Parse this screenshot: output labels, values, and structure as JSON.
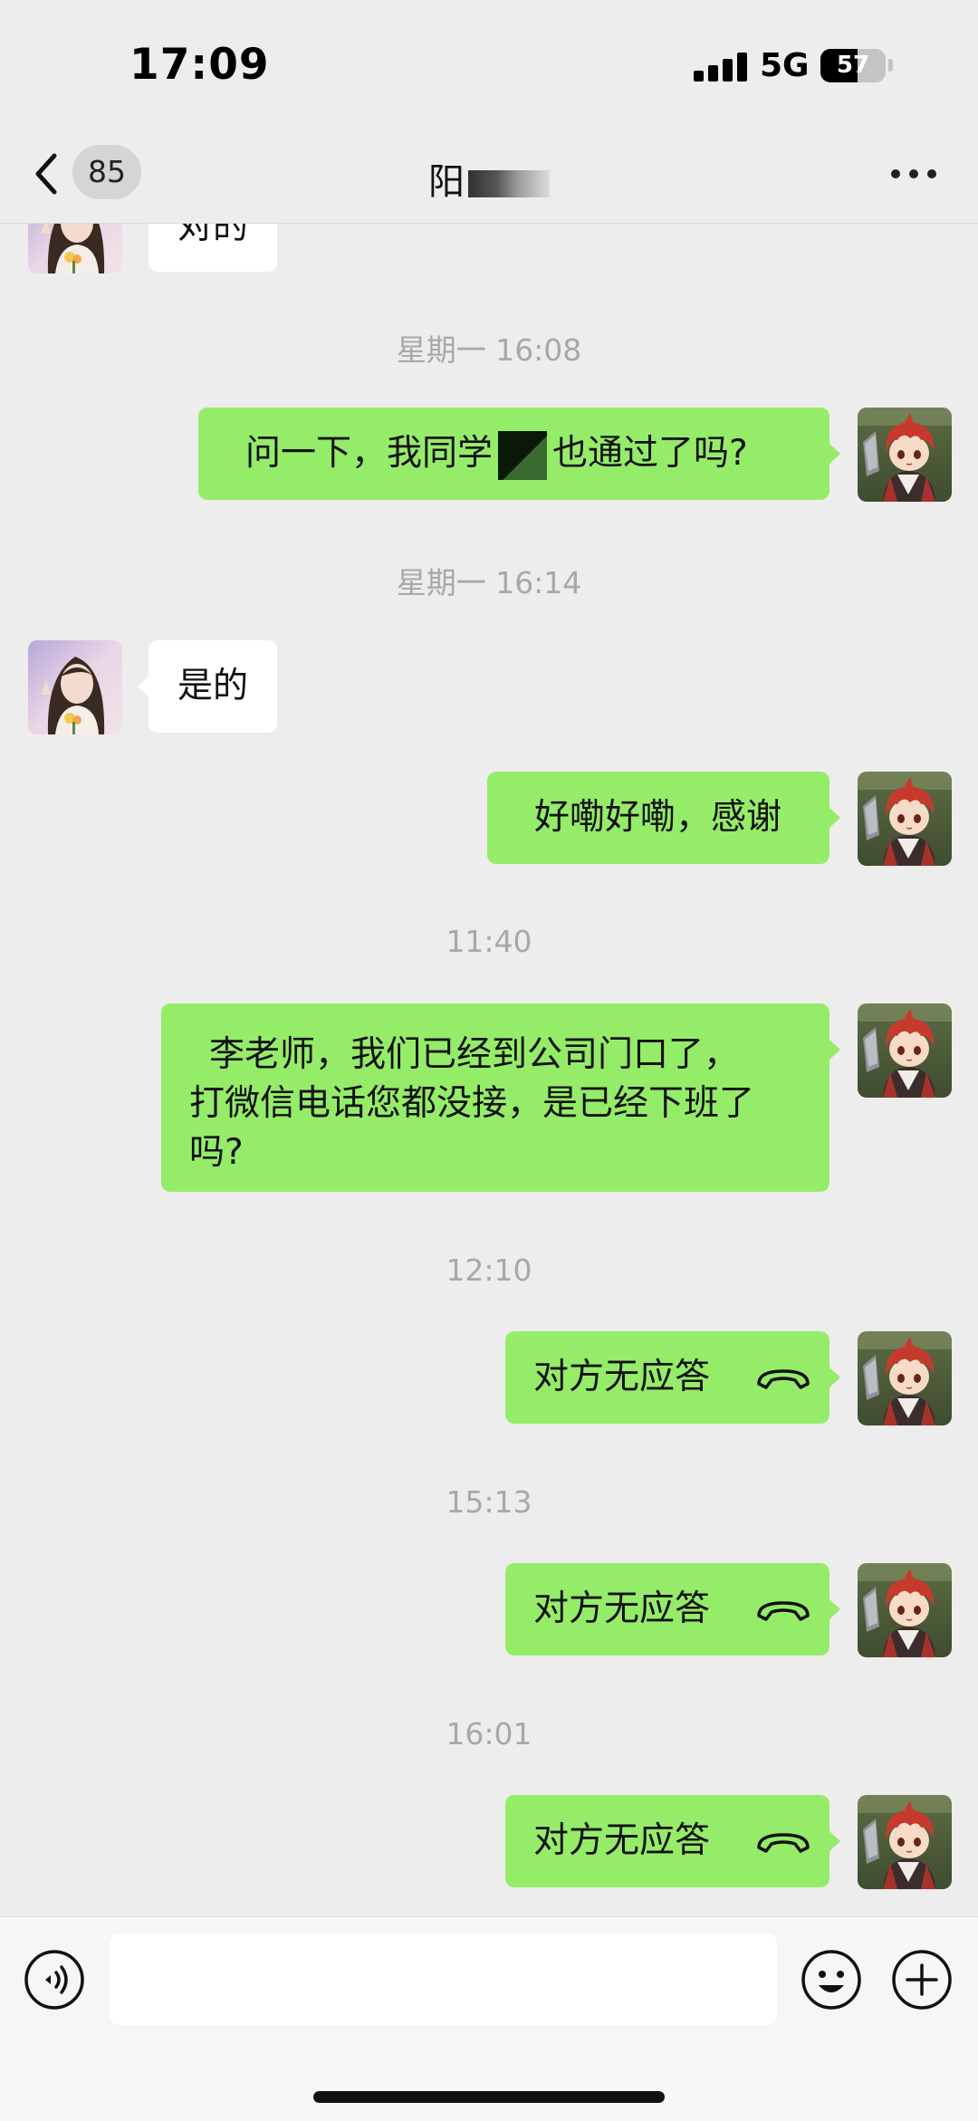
{
  "status_bar": {
    "time": "17:09",
    "network": "5G",
    "battery": "57",
    "battery_level": 0.57
  },
  "header": {
    "back_badge": "85",
    "title": "阳"
  },
  "messages": [
    {
      "text": "对的"
    },
    {
      "timestamp": "星期一 16:08"
    },
    {
      "text_before": "问一下，我同学",
      "text_after": "也通过了吗?"
    },
    {
      "timestamp": "星期一 16:14"
    },
    {
      "text": "是的"
    },
    {
      "text": "好嘞好嘞，感谢"
    },
    {
      "timestamp": "11:40"
    },
    {
      "lines": [
        "李老师，我们已经到公司门口了，",
        "打微信电话您都没接，是已经下班了",
        "吗?"
      ]
    },
    {
      "timestamp": "12:10"
    },
    {
      "text": "对方无应答",
      "icon": "phone-hangup-icon"
    },
    {
      "timestamp": "15:13"
    },
    {
      "text": "对方无应答",
      "icon": "phone-hangup-icon"
    },
    {
      "timestamp": "16:01"
    },
    {
      "text": "对方无应答",
      "icon": "phone-hangup-icon"
    }
  ],
  "input_bar": {
    "voice_icon": "voice-icon",
    "emoji_icon": "emoji-icon",
    "add_icon": "plus-icon"
  },
  "colors": {
    "background": "#ededed",
    "outgoing_bubble": "#95ec69",
    "incoming_bubble": "#ffffff",
    "timestamp": "#a8a8a8"
  }
}
